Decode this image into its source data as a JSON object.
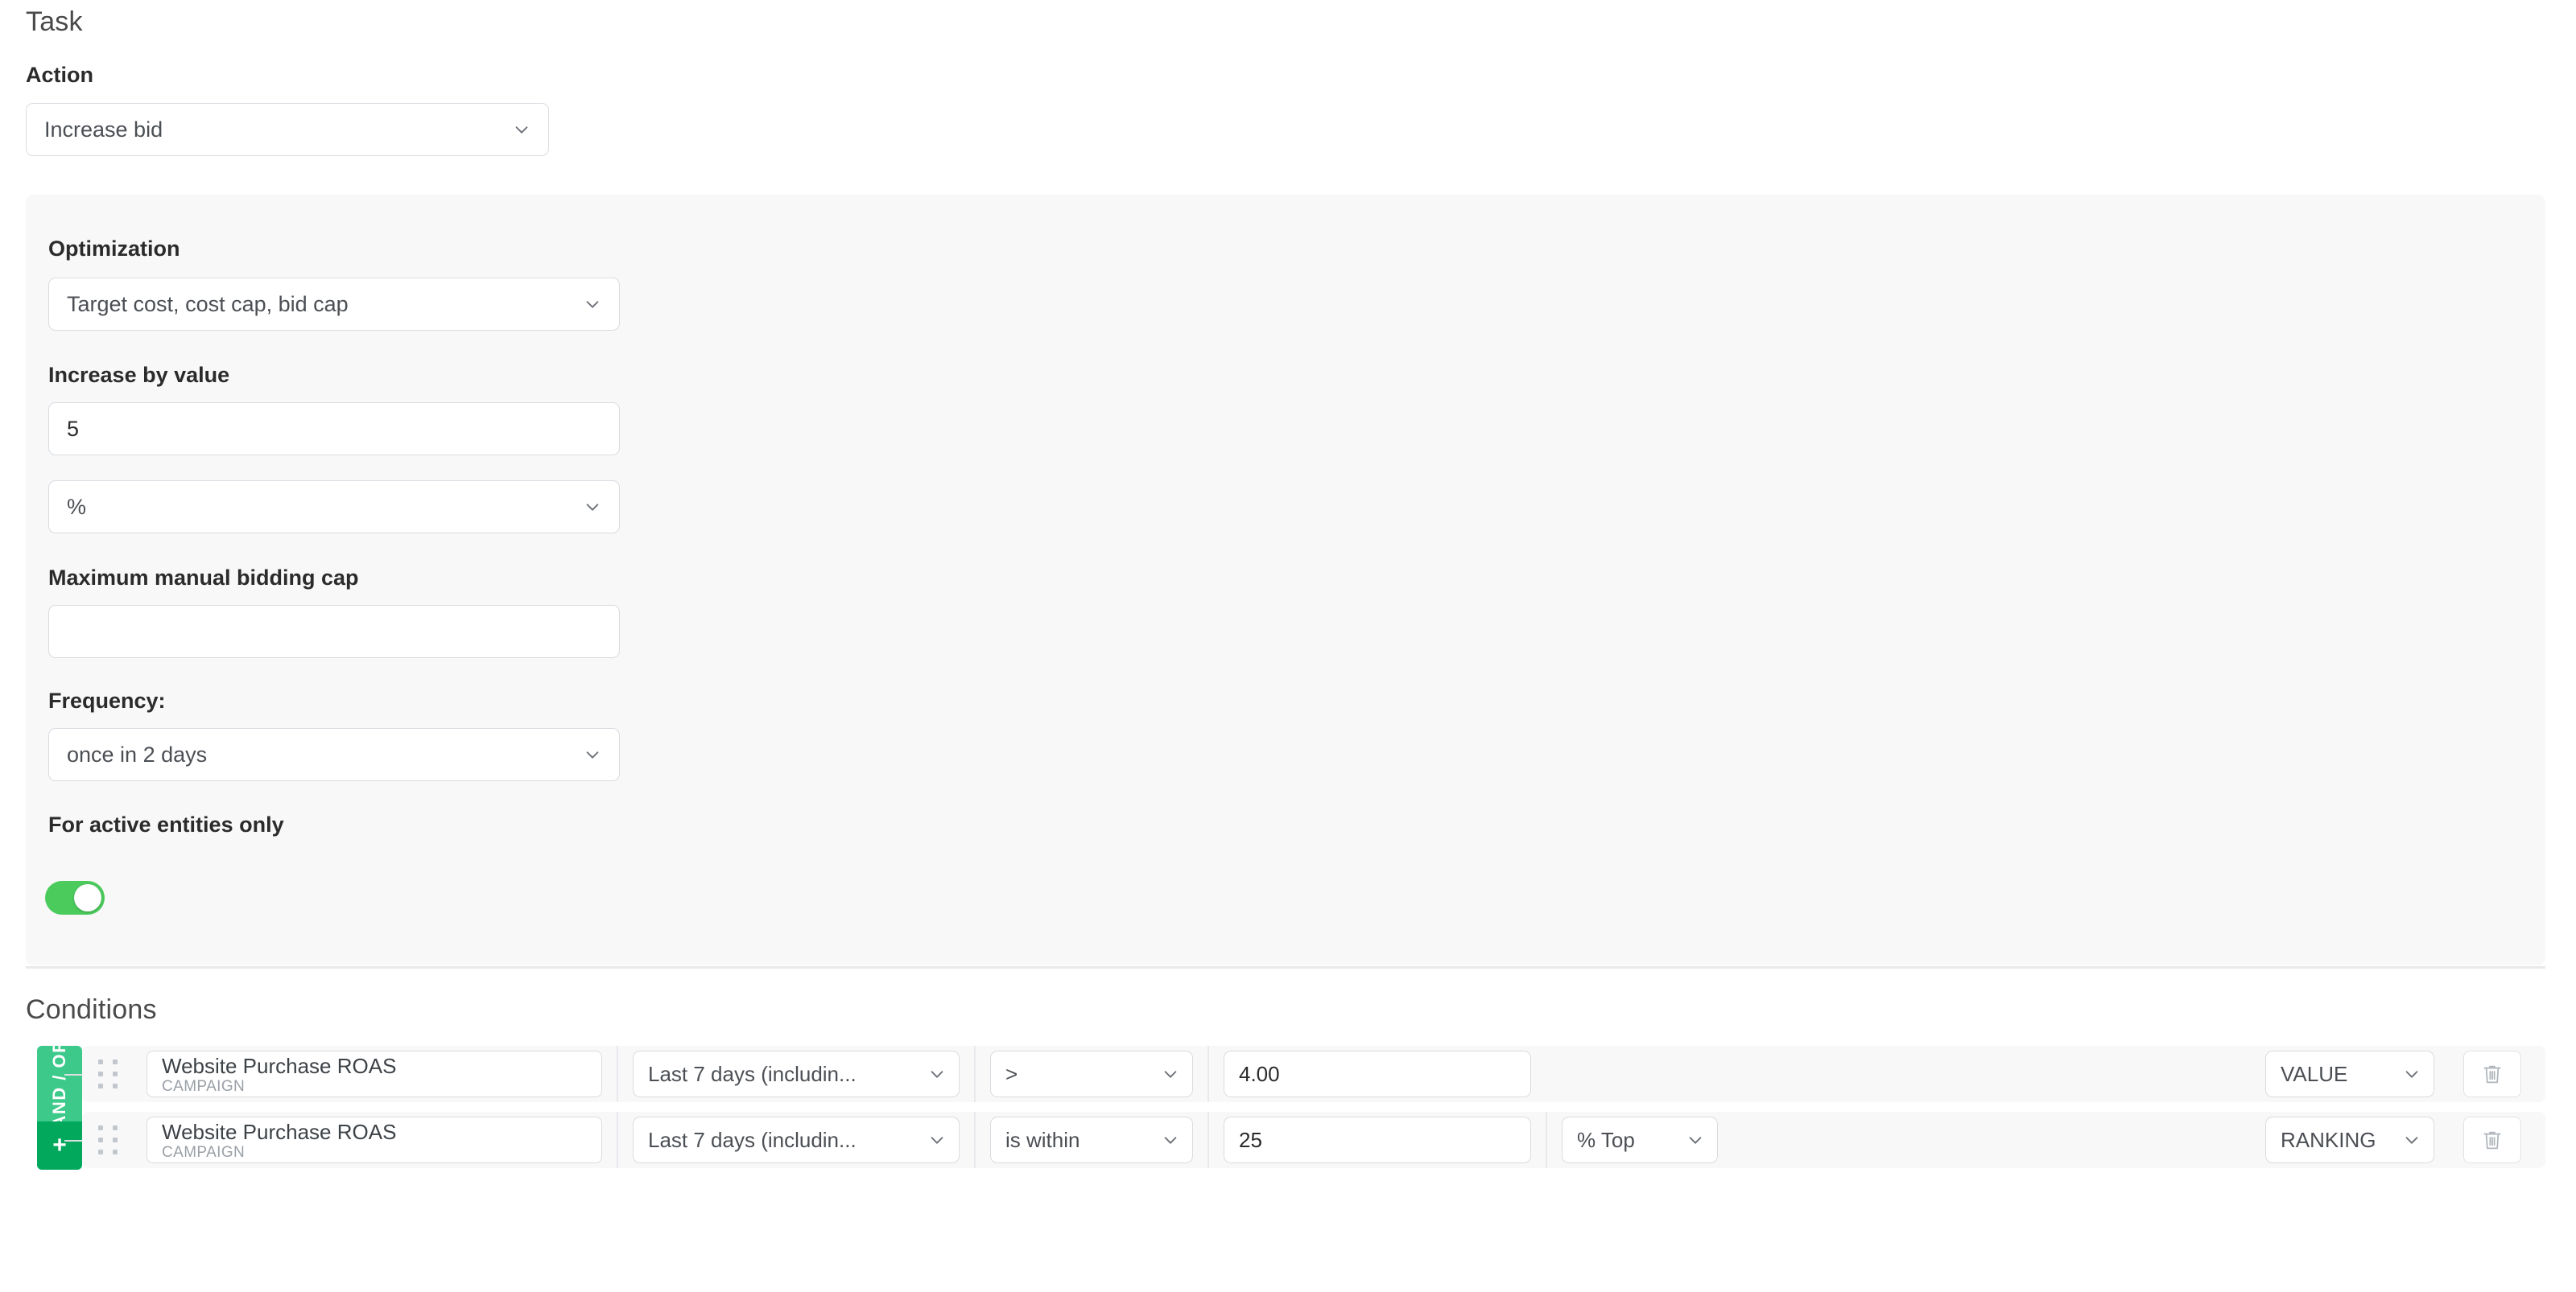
{
  "task": {
    "title": "Task",
    "action_label": "Action",
    "action_value": "Increase bid"
  },
  "settings": {
    "optimization_label": "Optimization",
    "optimization_value": "Target cost, cost cap, bid cap",
    "increase_by_label": "Increase by value",
    "increase_by_value": "5",
    "increase_unit_value": "%",
    "max_cap_label": "Maximum manual bidding cap",
    "max_cap_value": "",
    "max_cap_placeholder": "",
    "frequency_label": "Frequency:",
    "frequency_value": "once in 2 days",
    "active_only_label": "For active entities only",
    "active_only_on": true
  },
  "conditions": {
    "title": "Conditions",
    "group_operator_label": "AND / OR",
    "add_label": "+",
    "rows": [
      {
        "metric": "Website Purchase ROAS",
        "level": "CAMPAIGN",
        "range": "Last 7 days (includin...",
        "operator": ">",
        "value": "4.00",
        "unit": "",
        "type": "VALUE",
        "delete_icon": "trash-icon"
      },
      {
        "metric": "Website Purchase ROAS",
        "level": "CAMPAIGN",
        "range": "Last 7 days (includin...",
        "operator": "is within",
        "value": "25",
        "unit": "% Top",
        "type": "RANKING",
        "delete_icon": "trash-icon"
      }
    ]
  },
  "colors": {
    "toggle_on": "#4ccb5d",
    "rail_andor": "#3cc98a",
    "rail_plus": "#02a85c",
    "panel_bg": "#f8f8f9"
  }
}
